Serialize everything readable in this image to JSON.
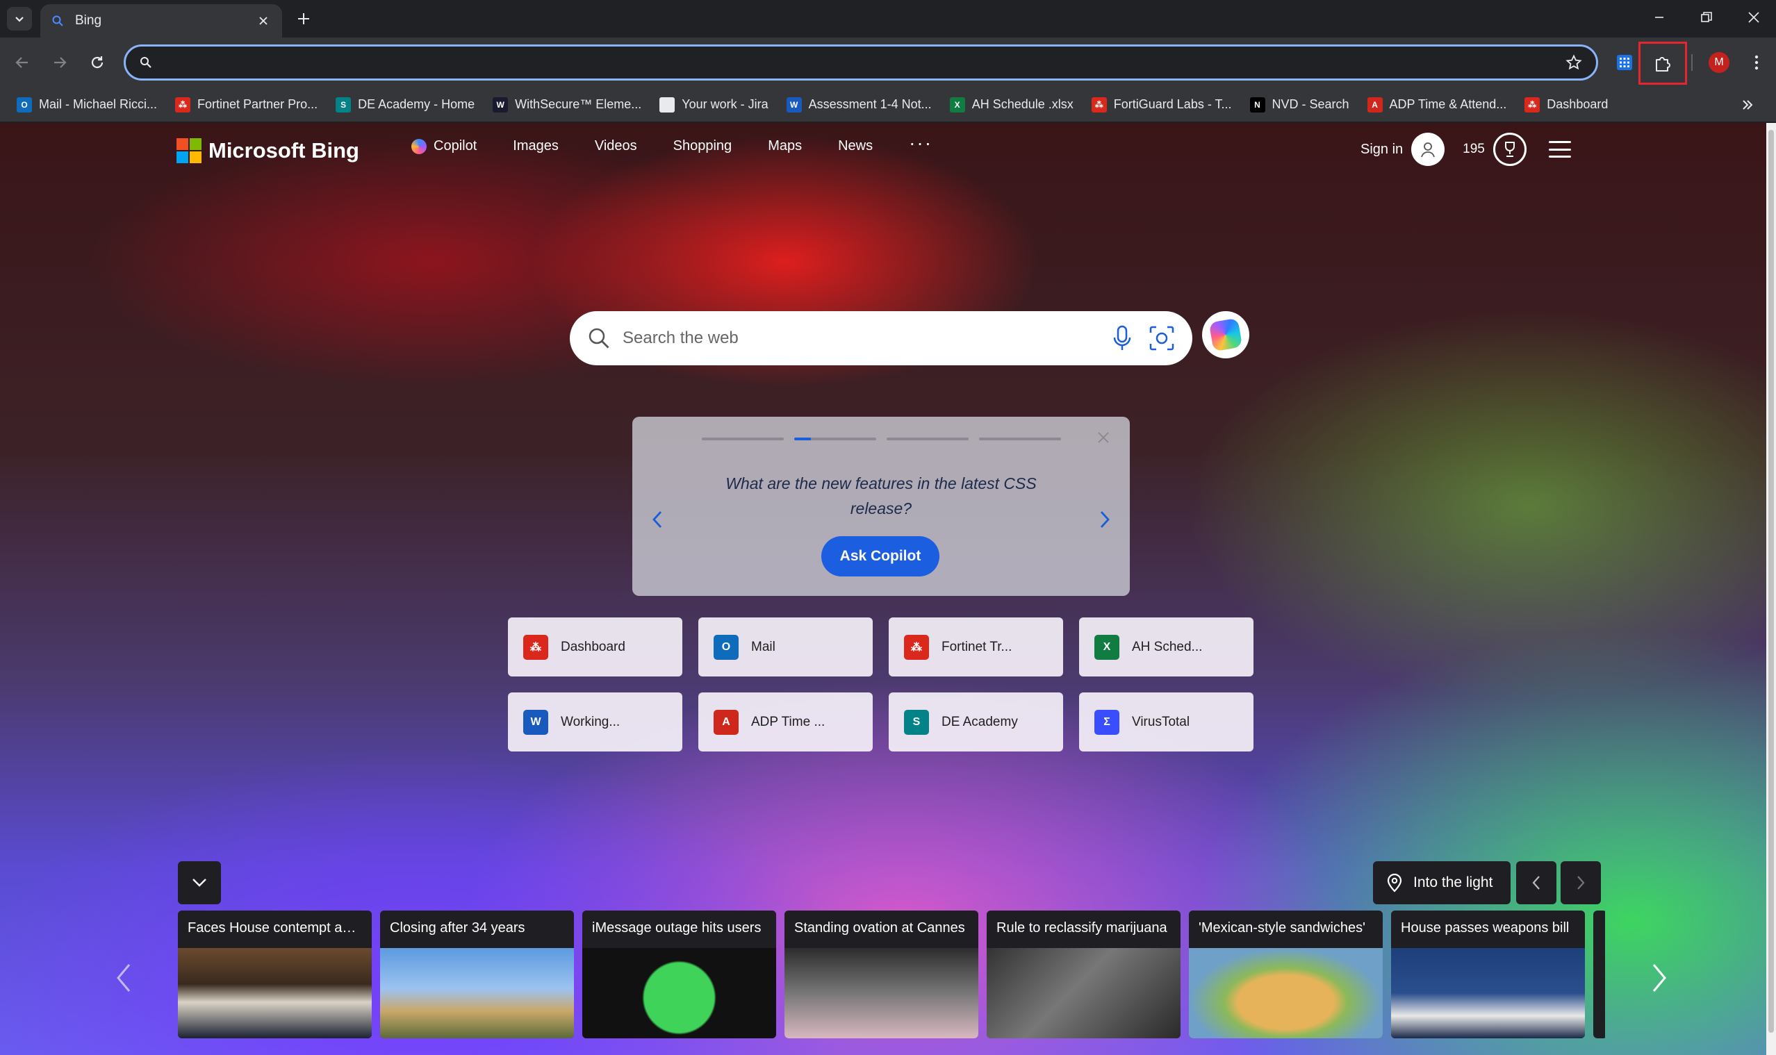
{
  "browser": {
    "tab_title": "Bing",
    "omnibox_value": "",
    "profile_initial": "M",
    "bookmarks": [
      {
        "label": "Mail - Michael Ricci...",
        "icon": "outlook-icon",
        "color": "#0f6cbd"
      },
      {
        "label": "Fortinet Partner Pro...",
        "icon": "fortinet-icon",
        "color": "#da291c"
      },
      {
        "label": "DE Academy - Home",
        "icon": "sharepoint-icon",
        "color": "#038387"
      },
      {
        "label": "WithSecure™ Eleme...",
        "icon": "withsecure-icon",
        "color": "#1a1a2e"
      },
      {
        "label": "Your work - Jira",
        "icon": "page-icon",
        "color": "#e8eaed"
      },
      {
        "label": "Assessment 1-4 Not...",
        "icon": "word-icon",
        "color": "#185abd"
      },
      {
        "label": "AH Schedule .xlsx",
        "icon": "excel-icon",
        "color": "#107c41"
      },
      {
        "label": "FortiGuard Labs - T...",
        "icon": "fortinet-icon",
        "color": "#da291c"
      },
      {
        "label": "NVD - Search",
        "icon": "nvd-icon",
        "color": "#000000"
      },
      {
        "label": "ADP Time & Attend...",
        "icon": "adp-icon",
        "color": "#d0271d"
      },
      {
        "label": "Dashboard",
        "icon": "fortinet-icon",
        "color": "#da291c"
      }
    ]
  },
  "bing": {
    "logo_text": "Microsoft Bing",
    "nav": [
      "Copilot",
      "Images",
      "Videos",
      "Shopping",
      "Maps",
      "News"
    ],
    "nav_more": "···",
    "sign_in": "Sign in",
    "points": "195",
    "search_placeholder": "Search the web",
    "copilot_card": {
      "question": "What are the new features in the latest CSS release?",
      "button": "Ask Copilot"
    },
    "quick_links": [
      {
        "label": "Dashboard",
        "icon": "fortinet-icon",
        "color": "#da291c"
      },
      {
        "label": "Mail",
        "icon": "outlook-icon",
        "color": "#0f6cbd"
      },
      {
        "label": "Fortinet Tr...",
        "icon": "fortinet-icon",
        "color": "#da291c"
      },
      {
        "label": "AH Sched...",
        "icon": "excel-icon",
        "color": "#107c41"
      },
      {
        "label": "Working...",
        "icon": "word-icon",
        "color": "#185abd"
      },
      {
        "label": "ADP Time ...",
        "icon": "adp-icon",
        "color": "#d0271d"
      },
      {
        "label": "DE Academy",
        "icon": "sharepoint-icon",
        "color": "#038387"
      },
      {
        "label": "VirusTotal",
        "icon": "virustotal-icon",
        "color": "#394eff"
      }
    ],
    "image_title": "Into the light",
    "news": [
      {
        "title": "Faces House contempt acti..."
      },
      {
        "title": "Closing after 34 years"
      },
      {
        "title": "iMessage outage hits users"
      },
      {
        "title": "Standing ovation at Cannes"
      },
      {
        "title": "Rule to reclassify marijuana"
      },
      {
        "title": "'Mexican-style sandwiches'"
      },
      {
        "title": "House passes weapons bill"
      }
    ]
  },
  "colors": {
    "accent_blue": "#1c5ee0",
    "omnibox_focus": "#8ab4f8",
    "highlight_red": "#e3262f"
  }
}
